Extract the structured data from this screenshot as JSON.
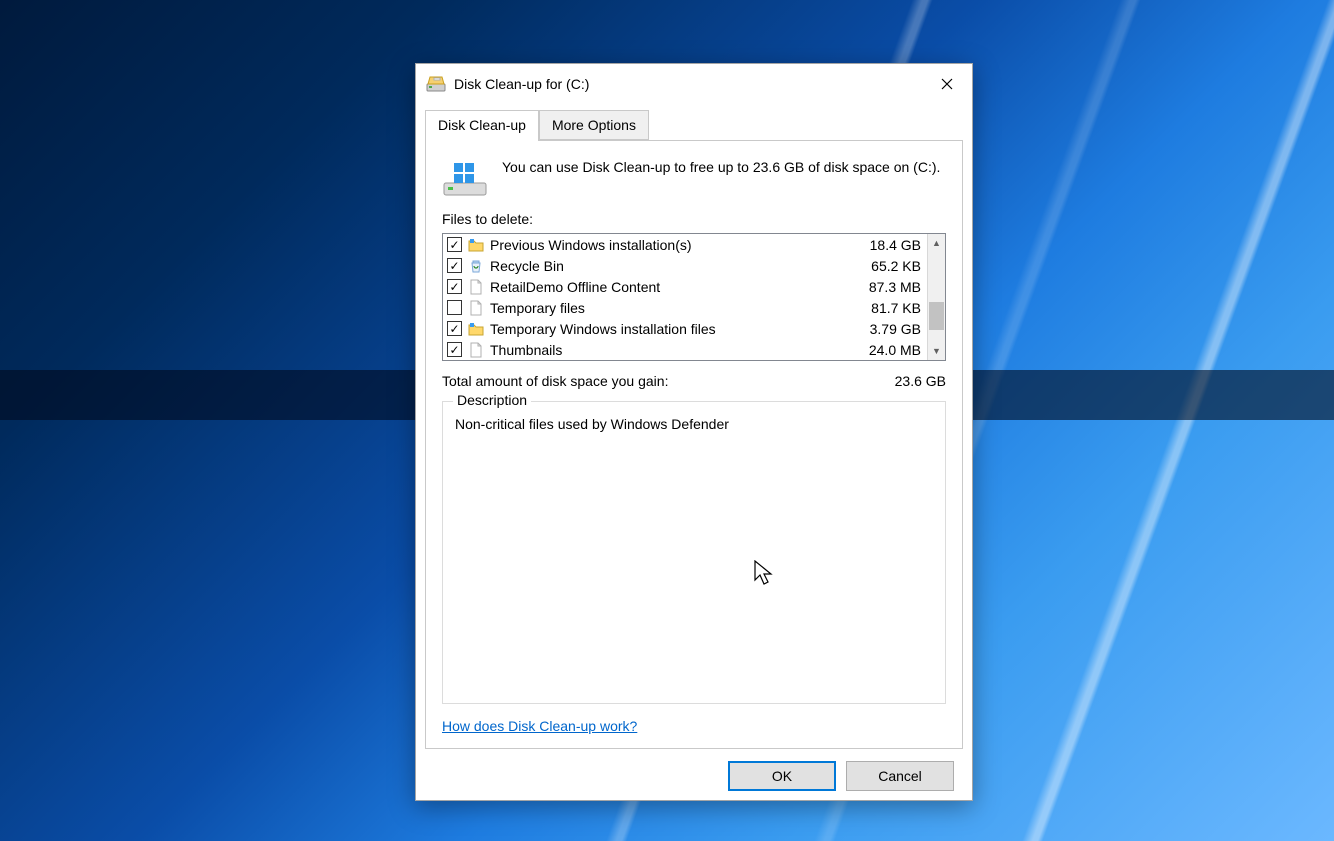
{
  "title": "Disk Clean-up for  (C:)",
  "tabs": {
    "cleanup": "Disk Clean-up",
    "more": "More Options"
  },
  "intro": "You can use Disk Clean-up to free up to 23.6 GB of disk space on  (C:).",
  "files_label": "Files to delete:",
  "files": [
    {
      "checked": true,
      "icon": "folder-icon",
      "label": "Previous Windows installation(s)",
      "size": "18.4 GB"
    },
    {
      "checked": true,
      "icon": "recycle-icon",
      "label": "Recycle Bin",
      "size": "65.2 KB"
    },
    {
      "checked": true,
      "icon": "file-icon",
      "label": "RetailDemo Offline Content",
      "size": "87.3 MB"
    },
    {
      "checked": false,
      "icon": "file-icon",
      "label": "Temporary files",
      "size": "81.7 KB"
    },
    {
      "checked": true,
      "icon": "folder-icon",
      "label": "Temporary Windows installation files",
      "size": "3.79 GB"
    },
    {
      "checked": true,
      "icon": "file-icon",
      "label": "Thumbnails",
      "size": "24.0 MB"
    }
  ],
  "total_label": "Total amount of disk space you gain:",
  "total_value": "23.6 GB",
  "description_label": "Description",
  "description_text": "Non-critical files used by Windows Defender",
  "help_link": "How does Disk Clean-up work?",
  "buttons": {
    "ok": "OK",
    "cancel": "Cancel"
  }
}
